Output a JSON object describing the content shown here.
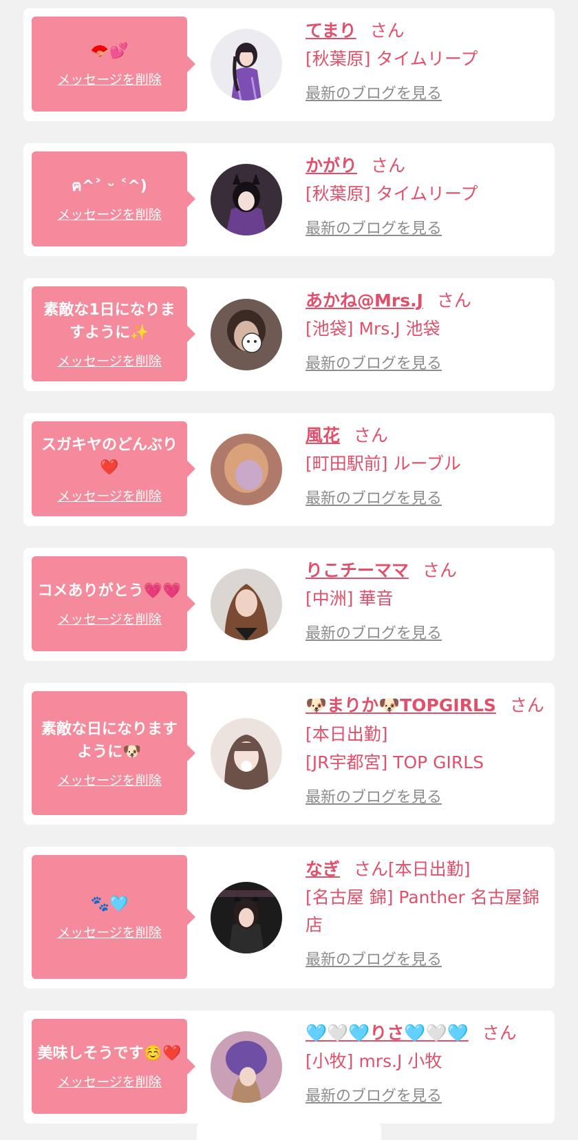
{
  "delete_label": "メッセージを削除",
  "blog_label": "最新のブログを見る",
  "san_label": "さん",
  "colors": {
    "bubble": "#f48a9b",
    "accent": "#e0506a",
    "link_gray": "#8c8c8c",
    "background": "#f1f1f1"
  },
  "cards": [
    {
      "message": "🪭💕",
      "name": "てまり",
      "status": "",
      "shop": "[秋葉原] タイムリープ",
      "avatar": "girl-in-purple-kimono-photo"
    },
    {
      "message": "ฅ^˃ ᵕ ˂^)",
      "name": "かがり",
      "status": "",
      "shop": "[秋葉原] タイムリープ",
      "avatar": "girl-with-cat-ears-photo"
    },
    {
      "message": "素敵な1日になりますように✨",
      "name": "あかね@Mrs.J",
      "status": "",
      "shop": "[池袋] Mrs.J 池袋",
      "avatar": "woman-face-masked-photo"
    },
    {
      "message": "スガキヤのどんぶり❤️",
      "name": "風花",
      "status": "",
      "shop": "[町田駅前] ルーブル",
      "avatar": "blonde-girl-photo"
    },
    {
      "message": "コメありがとう💗💗",
      "name": "りこチーママ",
      "status": "",
      "shop": "[中洲] 華音",
      "avatar": "woman-brown-hair-photo"
    },
    {
      "message": "素敵な日になりますように🐶",
      "name": "🐶まりか🐶TOPGIRLS",
      "status": "[本日出勤]",
      "shop": "[JR宇都宮] TOP GIRLS",
      "avatar": "girl-with-bangs-photo"
    },
    {
      "message": "🐾🩵",
      "name": "なぎ",
      "status": "[本日出勤]",
      "shop": "[名古屋 錦] Panther 名古屋錦店",
      "avatar": "girl-cat-ears-panther-photo"
    },
    {
      "message": "美味しそうです☺️❤️",
      "name": "🩵🤍🩵りさ🩵🤍🩵",
      "status": "",
      "shop": "[小牧] mrs.J 小牧",
      "avatar": "girl-purple-filter-photo"
    }
  ]
}
